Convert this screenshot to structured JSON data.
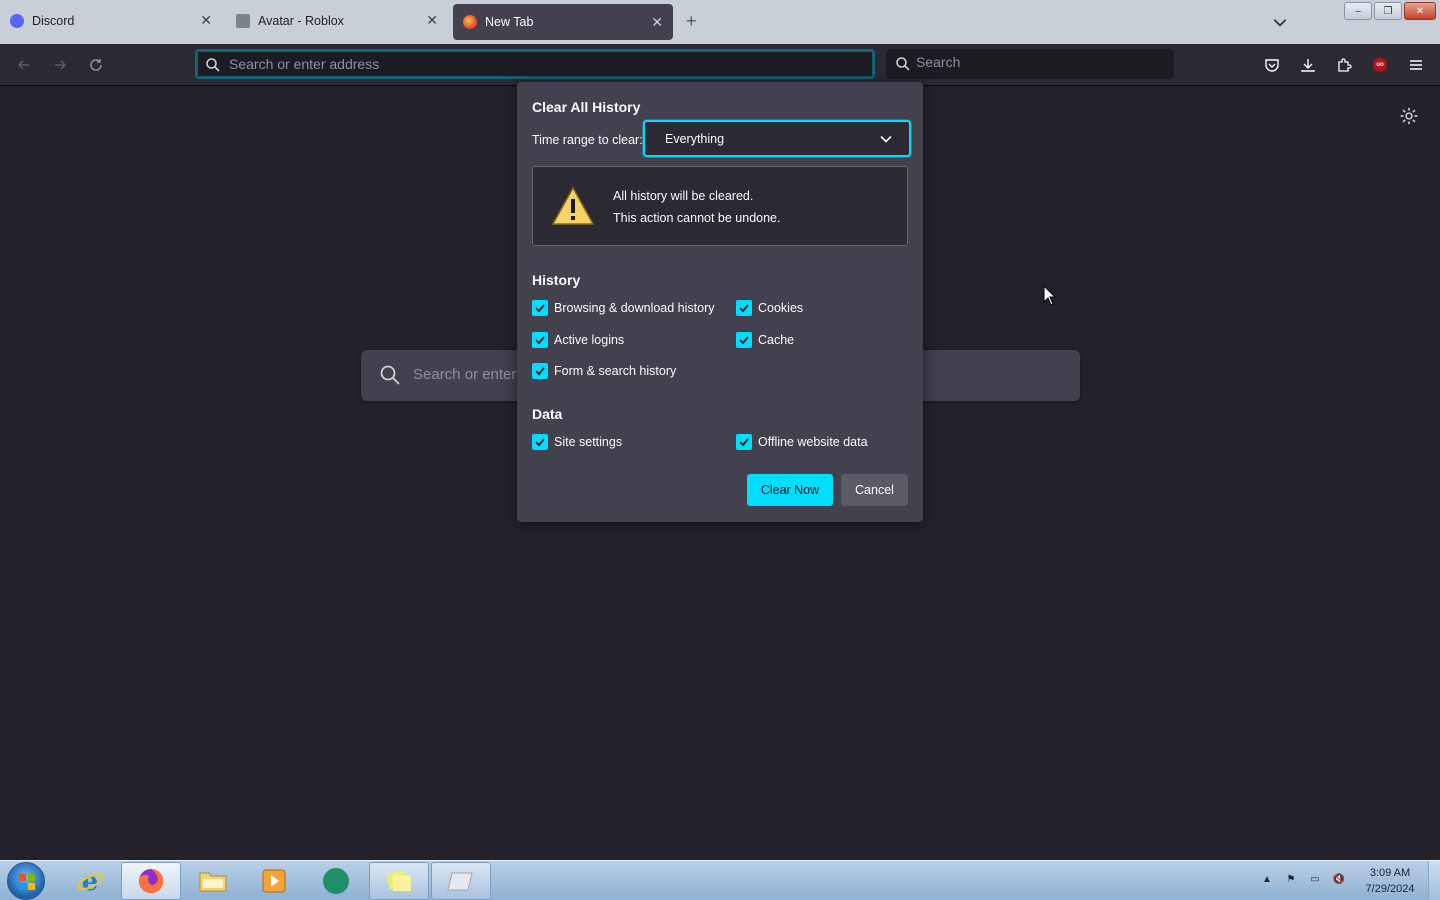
{
  "window": {
    "tabs": [
      {
        "title": "Discord",
        "icon": "discord-icon",
        "active": false
      },
      {
        "title": "Avatar - Roblox",
        "icon": "roblox-icon",
        "active": false
      },
      {
        "title": "New Tab",
        "icon": "firefox-icon",
        "active": true
      }
    ],
    "controls": {
      "minimize": "–",
      "restore": "❐",
      "close": "✕"
    }
  },
  "toolbar": {
    "address_placeholder": "Search or enter address",
    "search_placeholder": "Search"
  },
  "newtab": {
    "search_placeholder": "Search or enter address"
  },
  "dialog": {
    "title": "Clear All History",
    "time_range_label": "Time range to clear:",
    "time_range_value": "Everything",
    "warning_line1": "All history will be cleared.",
    "warning_line2": "This action cannot be undone.",
    "history_heading": "History",
    "history_items": [
      {
        "label": "Browsing & download history",
        "checked": true
      },
      {
        "label": "Cookies",
        "checked": true
      },
      {
        "label": "Active logins",
        "checked": true
      },
      {
        "label": "Cache",
        "checked": true
      },
      {
        "label": "Form & search history",
        "checked": true
      }
    ],
    "data_heading": "Data",
    "data_items": [
      {
        "label": "Site settings",
        "checked": true
      },
      {
        "label": "Offline website data",
        "checked": true
      }
    ],
    "clear_button": "Clear Now",
    "cancel_button": "Cancel"
  },
  "taskbar": {
    "clock_time": "3:09 AM",
    "clock_date": "7/29/2024"
  },
  "colors": {
    "accent": "#00ddff",
    "page_bg": "#23222b",
    "dialog_bg": "#42414d"
  }
}
